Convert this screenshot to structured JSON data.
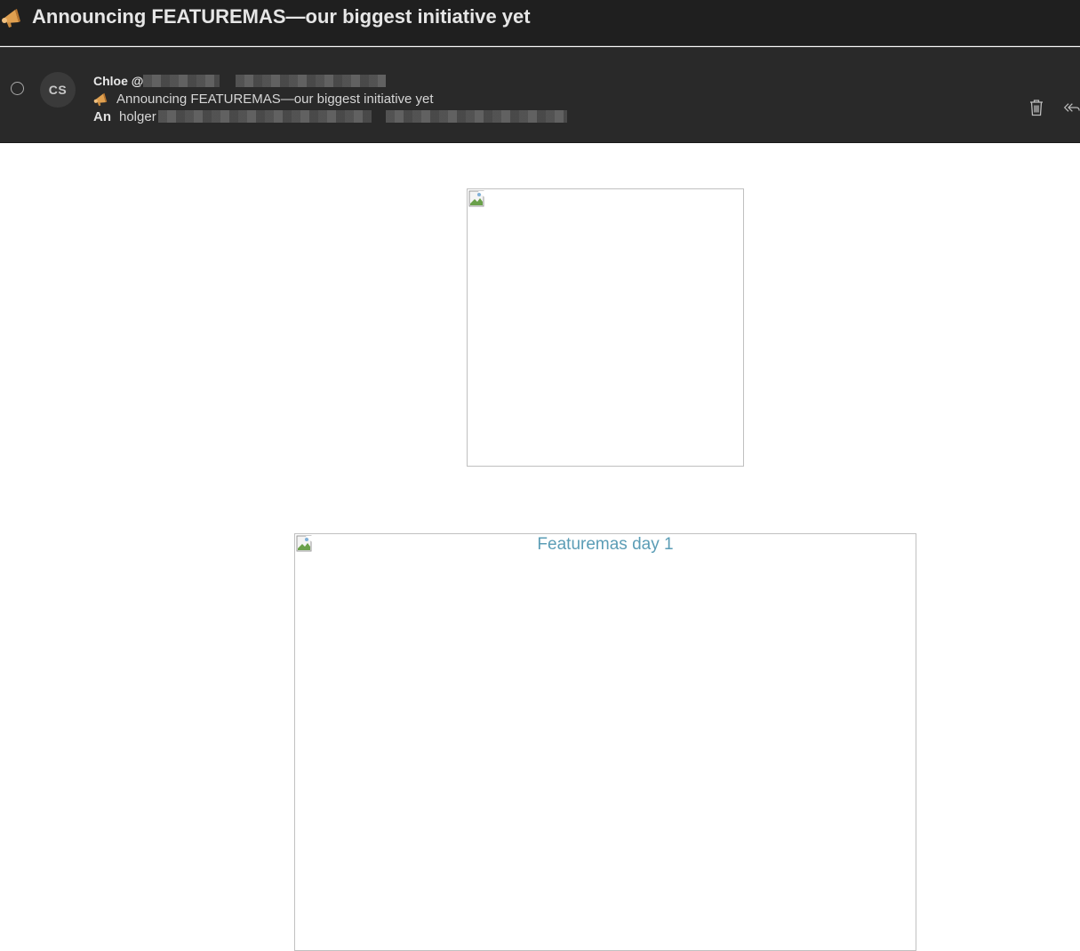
{
  "window": {
    "title": "Announcing FEATUREMAS—our biggest initiative yet",
    "title_icon": "megaphone-icon"
  },
  "message": {
    "avatar_initials": "CS",
    "sender_name": "Chloe @ ",
    "subject": "Announcing FEATUREMAS—our biggest initiative yet",
    "subject_icon": "megaphone-icon",
    "to_label": "An",
    "to_value": "holger",
    "actions": {
      "delete_icon": "trash-icon",
      "reply_all_icon": "reply-all-icon"
    }
  },
  "body": {
    "logo_image_alt": "",
    "day_image_alt": "Featuremas day 1",
    "alt_text_color": "#5b9db6"
  },
  "colors": {
    "title_bar_bg": "#1f1f1f",
    "header_bg": "#292929",
    "megaphone": "#e0a050"
  }
}
